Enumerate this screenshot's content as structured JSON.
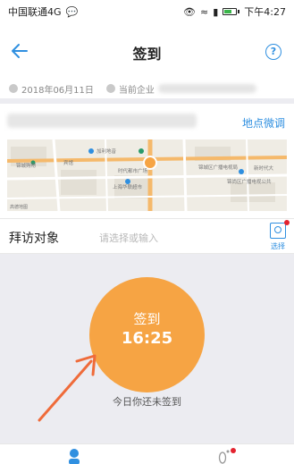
{
  "status_bar": {
    "carrier": "中国联通4G",
    "time": "下午4:27"
  },
  "nav": {
    "title": "签到",
    "back_icon": "back-arrow-icon",
    "help_icon": "question-icon",
    "help_glyph": "?"
  },
  "info": {
    "date": "2018年06月11日",
    "company_label": "当前企业"
  },
  "location": {
    "adjust_label": "地点微调",
    "map_labels": {
      "plaza": "加利地音",
      "building": "时代都市广场",
      "school": "上海华联超市",
      "district": "锦城区广播电视局",
      "district2": "新时代大",
      "district3": "锦尚区广播电视公共",
      "mall": "锦城购物",
      "brand": "高德地图",
      "hotel": "宾馆"
    }
  },
  "visit": {
    "label": "拜访对象",
    "placeholder": "请选择或输入",
    "picker_label": "选择"
  },
  "checkin": {
    "label": "签到",
    "time": "16:25",
    "status": "今日你还未签到"
  },
  "colors": {
    "accent": "#2f8fe0",
    "checkin": "#f6a444",
    "arrow": "#ef6b3a",
    "badge": "#e3232f"
  }
}
